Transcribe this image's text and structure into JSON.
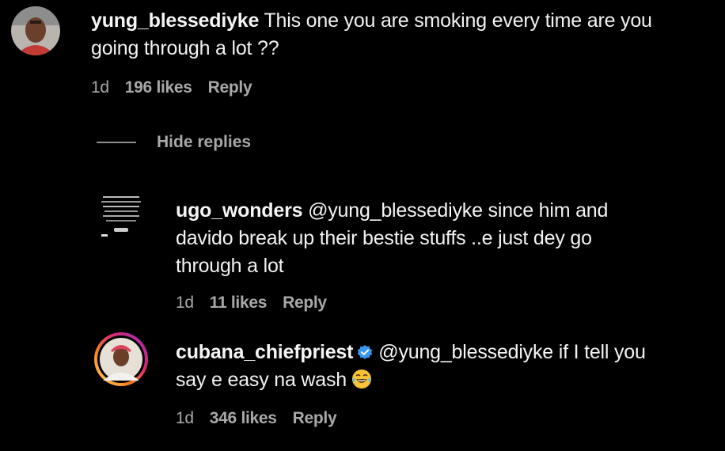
{
  "comments": [
    {
      "username": "yung_blessediyke",
      "text_line1": "This one you are smoking every time are you",
      "text_line2": "going through a lot ??",
      "time": "1d",
      "likes": "196 likes",
      "reply_label": "Reply",
      "avatar_icon": "profile-photo"
    }
  ],
  "thread": {
    "toggle_label": "Hide replies"
  },
  "replies": [
    {
      "username": "ugo_wonders",
      "mention": "@yung_blessediyke",
      "text_line1": "since him and",
      "text_line2": "davido break up their bestie stuffs ..e just dey go",
      "text_line3": "through a lot",
      "time": "1d",
      "likes": "11 likes",
      "reply_label": "Reply",
      "avatar_icon": "text-image-avatar"
    },
    {
      "username": "cubana_chiefpriest",
      "verified_icon": "verified-badge-icon",
      "mention": "@yung_blessediyke",
      "text_line1": "if I tell you",
      "text_line2": "say e easy na wash",
      "emoji_icon": "laughing-emoji-icon",
      "time": "1d",
      "likes": "346 likes",
      "reply_label": "Reply",
      "avatar_icon": "story-ring-avatar"
    }
  ],
  "colors": {
    "background": "#000000",
    "text": "#f5f5f5",
    "meta": "#a8a8a8",
    "verified": "#3897f0"
  }
}
